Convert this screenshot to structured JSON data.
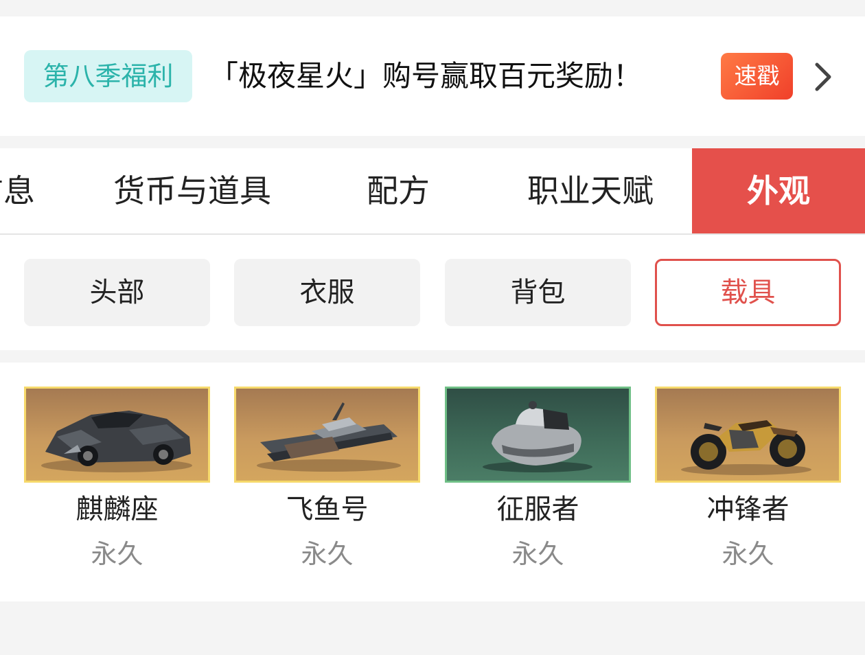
{
  "banner": {
    "tag": "第八季福利",
    "text": "「极夜星火」购号赢取百元奖励！",
    "button": "速戳"
  },
  "tabs": [
    {
      "label": "信息"
    },
    {
      "label": "货币与道具"
    },
    {
      "label": "配方"
    },
    {
      "label": "职业天赋"
    },
    {
      "label": "外观",
      "active": true
    }
  ],
  "subtabs": [
    {
      "label": "头部"
    },
    {
      "label": "衣服"
    },
    {
      "label": "背包"
    },
    {
      "label": "载具",
      "active": true
    }
  ],
  "items": [
    {
      "name": "麒麟座",
      "duration": "永久",
      "icon": "sports-car-icon",
      "frame": "gold"
    },
    {
      "name": "飞鱼号",
      "duration": "永久",
      "icon": "boat-icon",
      "frame": "gold"
    },
    {
      "name": "征服者",
      "duration": "永久",
      "icon": "jet-ski-icon",
      "frame": "green"
    },
    {
      "name": "冲锋者",
      "duration": "永久",
      "icon": "motorcycle-icon",
      "frame": "gold"
    }
  ],
  "colors": {
    "accent": "#e5504b",
    "tag_bg": "#d7f5f4",
    "tag_text": "#2bb3aa",
    "gold_frame": "#f6d96b",
    "green_frame": "#6fbf86"
  }
}
